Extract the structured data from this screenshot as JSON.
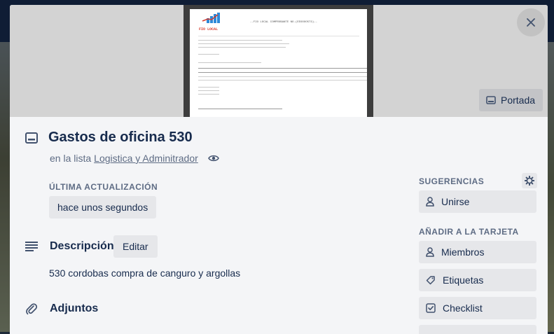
{
  "card": {
    "title": "Gastos de oficina 530",
    "list_prefix": "en la lista",
    "list_name": "Logistica y Adminitrador",
    "cover_button": "Portada",
    "last_update_label": "ÚLTIMA ACTUALIZACIÓN",
    "last_update_value": "hace unos segundos",
    "description_heading": "Descripción",
    "edit_label": "Editar",
    "description_text": "530 cordobas compra de canguro y argollas",
    "attachments_heading": "Adjuntos"
  },
  "cover_doc": {
    "header": "--FIO LOCAL COMPROBANTE NO.(EEOOOO573)--",
    "logo_text": "FIO LOCAL"
  },
  "sidebar": {
    "suggestions_label": "SUGERENCIAS",
    "join_label": "Unirse",
    "add_label": "AÑADIR A LA TARJETA",
    "items": [
      {
        "label": "Miembros",
        "icon": "person-icon"
      },
      {
        "label": "Etiquetas",
        "icon": "tag-icon"
      },
      {
        "label": "Checklist",
        "icon": "checklist-icon"
      }
    ]
  },
  "colors": {
    "card_bg": "#f4f5f7",
    "text_primary": "#172b4d",
    "text_secondary": "#5e6c84",
    "button_bg": "#e6e7ea",
    "logo_red": "#d63a2b",
    "logo_blue": "#2e8ad8"
  }
}
